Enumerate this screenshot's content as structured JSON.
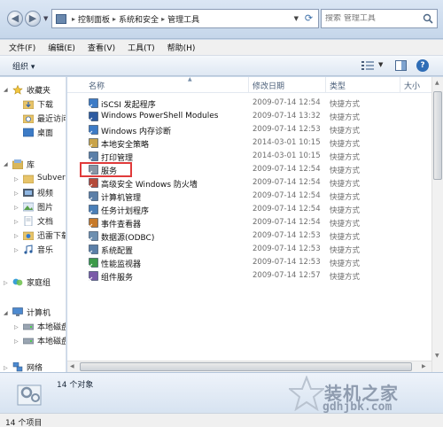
{
  "address": {
    "crumbs": [
      "控制面板",
      "系统和安全",
      "管理工具"
    ],
    "search_placeholder": "搜索 管理工具"
  },
  "menu": [
    "文件(F)",
    "编辑(E)",
    "查看(V)",
    "工具(T)",
    "帮助(H)"
  ],
  "toolbar": {
    "organize": "组织 ▾"
  },
  "nav": {
    "favorites": "收藏夹",
    "downloads": "下载",
    "recent": "最近访问",
    "desktop": "桌面",
    "libraries": "库",
    "subversion": "Subvers",
    "videos": "视频",
    "pictures": "图片",
    "documents": "文档",
    "xunlei": "迅雷下载",
    "music": "音乐",
    "homegroup": "家庭组",
    "computer": "计算机",
    "disk1": "本地磁盘",
    "disk2": "本地磁盘",
    "network": "网络"
  },
  "columns": {
    "name": "名称",
    "date": "修改日期",
    "type": "类型",
    "size": "大小"
  },
  "files": [
    {
      "name": "iSCSI 发起程序",
      "date": "2009-07-14 12:54",
      "type": "快捷方式",
      "size": "",
      "icon": "iscsi-icon"
    },
    {
      "name": "Windows PowerShell Modules",
      "date": "2009-07-14 13:32",
      "type": "快捷方式",
      "size": "",
      "icon": "powershell-icon"
    },
    {
      "name": "Windows 内存诊断",
      "date": "2009-07-14 12:53",
      "type": "快捷方式",
      "size": "",
      "icon": "memory-diagnostic-icon"
    },
    {
      "name": "本地安全策略",
      "date": "2014-03-01 10:15",
      "type": "快捷方式",
      "size": "",
      "icon": "security-policy-icon"
    },
    {
      "name": "打印管理",
      "date": "2014-03-01 10:15",
      "type": "快捷方式",
      "size": "",
      "icon": "print-management-icon"
    },
    {
      "name": "服务",
      "date": "2009-07-14 12:54",
      "type": "快捷方式",
      "size": "",
      "icon": "services-icon"
    },
    {
      "name": "高级安全 Windows 防火墙",
      "date": "2009-07-14 12:54",
      "type": "快捷方式",
      "size": "",
      "icon": "firewall-icon"
    },
    {
      "name": "计算机管理",
      "date": "2009-07-14 12:54",
      "type": "快捷方式",
      "size": "",
      "icon": "computer-management-icon"
    },
    {
      "name": "任务计划程序",
      "date": "2009-07-14 12:54",
      "type": "快捷方式",
      "size": "",
      "icon": "task-scheduler-icon"
    },
    {
      "name": "事件查看器",
      "date": "2009-07-14 12:54",
      "type": "快捷方式",
      "size": "",
      "icon": "event-viewer-icon"
    },
    {
      "name": "数据源(ODBC)",
      "date": "2009-07-14 12:53",
      "type": "快捷方式",
      "size": "",
      "icon": "odbc-icon"
    },
    {
      "name": "系统配置",
      "date": "2009-07-14 12:53",
      "type": "快捷方式",
      "size": "",
      "icon": "system-config-icon"
    },
    {
      "name": "性能监视器",
      "date": "2009-07-14 12:53",
      "type": "快捷方式",
      "size": "",
      "icon": "performance-monitor-icon"
    },
    {
      "name": "组件服务",
      "date": "2009-07-14 12:57",
      "type": "快捷方式",
      "size": "",
      "icon": "component-services-icon"
    }
  ],
  "details": {
    "count": "14 个对象"
  },
  "status": {
    "text": "14 个项目"
  },
  "watermark": {
    "title": "装机之家",
    "url": "gdhjbk.com"
  },
  "colors": {
    "highlight": "#e03a3a",
    "accent": "#2f6db6"
  }
}
